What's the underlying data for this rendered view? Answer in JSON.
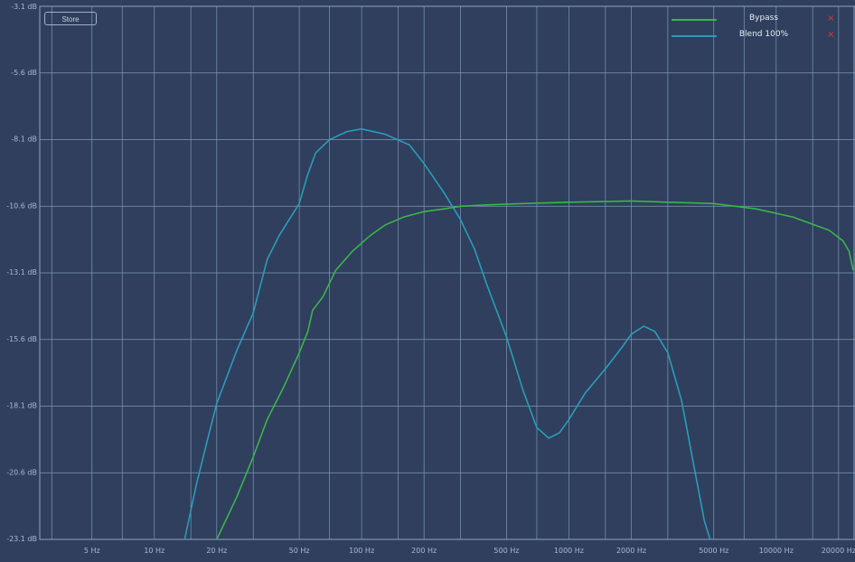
{
  "store_button": "Store",
  "legend": [
    {
      "label": "Bypass",
      "color": "#3bb54a",
      "remove": "×"
    },
    {
      "label": "Blend 100%",
      "color": "#2a9cbb",
      "remove": "×"
    }
  ],
  "chart_data": {
    "type": "line",
    "xscale": "log",
    "xlim": [
      2.8,
      24000
    ],
    "ylim": [
      -23.1,
      -3.1
    ],
    "grid": true,
    "legend_position": "top-right",
    "yticks": [
      -3.1,
      -5.6,
      -8.1,
      -10.6,
      -13.1,
      -15.6,
      -18.1,
      -20.6,
      -23.1
    ],
    "ytick_labels": [
      "-3.1 dB",
      "-5.6 dB",
      "-8.1 dB",
      "-10.6 dB",
      "-13.1 dB",
      "-15.6 dB",
      "-18.1 dB",
      "-20.6 dB",
      "-23.1 dB"
    ],
    "xticks": [
      5,
      10,
      20,
      50,
      100,
      200,
      500,
      1000,
      2000,
      5000,
      10000,
      20000
    ],
    "xtick_labels": [
      "5 Hz",
      "10 Hz",
      "20 Hz",
      "50 Hz",
      "100 Hz",
      "200 Hz",
      "500 Hz",
      "1000 Hz",
      "2000 Hz",
      "5000 Hz",
      "10000 Hz",
      "20000 Hz"
    ],
    "extra_gridlines_x": [
      3.2,
      7,
      15,
      30,
      70,
      150,
      300,
      700,
      1500,
      3000,
      7000,
      15000
    ],
    "series": [
      {
        "name": "Bypass",
        "color": "#3bb54a",
        "points": [
          [
            20,
            -23.1
          ],
          [
            25,
            -21.5
          ],
          [
            30,
            -20.0
          ],
          [
            35,
            -18.6
          ],
          [
            42,
            -17.4
          ],
          [
            50,
            -16.1
          ],
          [
            55,
            -15.3
          ],
          [
            58,
            -14.5
          ],
          [
            65,
            -14.0
          ],
          [
            75,
            -13.0
          ],
          [
            90,
            -12.3
          ],
          [
            110,
            -11.7
          ],
          [
            130,
            -11.3
          ],
          [
            160,
            -11.0
          ],
          [
            200,
            -10.8
          ],
          [
            250,
            -10.7
          ],
          [
            300,
            -10.6
          ],
          [
            400,
            -10.55
          ],
          [
            600,
            -10.5
          ],
          [
            1000,
            -10.45
          ],
          [
            2000,
            -10.4
          ],
          [
            3000,
            -10.45
          ],
          [
            5000,
            -10.5
          ],
          [
            8000,
            -10.7
          ],
          [
            12000,
            -11.0
          ],
          [
            18000,
            -11.5
          ],
          [
            21000,
            -11.9
          ],
          [
            22500,
            -12.3
          ],
          [
            23500,
            -13.0
          ]
        ]
      },
      {
        "name": "Blend 100%",
        "color": "#2a9cbb",
        "points": [
          [
            14,
            -23.1
          ],
          [
            16,
            -21.0
          ],
          [
            18,
            -19.4
          ],
          [
            20,
            -18.0
          ],
          [
            25,
            -16.0
          ],
          [
            30,
            -14.6
          ],
          [
            35,
            -12.6
          ],
          [
            40,
            -11.7
          ],
          [
            50,
            -10.5
          ],
          [
            55,
            -9.4
          ],
          [
            60,
            -8.6
          ],
          [
            70,
            -8.1
          ],
          [
            85,
            -7.8
          ],
          [
            100,
            -7.7
          ],
          [
            130,
            -7.9
          ],
          [
            170,
            -8.3
          ],
          [
            200,
            -9.0
          ],
          [
            250,
            -10.1
          ],
          [
            300,
            -11.1
          ],
          [
            350,
            -12.2
          ],
          [
            400,
            -13.5
          ],
          [
            500,
            -15.5
          ],
          [
            600,
            -17.5
          ],
          [
            700,
            -18.9
          ],
          [
            800,
            -19.3
          ],
          [
            900,
            -19.1
          ],
          [
            1000,
            -18.6
          ],
          [
            1200,
            -17.6
          ],
          [
            1500,
            -16.7
          ],
          [
            1800,
            -15.9
          ],
          [
            2000,
            -15.4
          ],
          [
            2300,
            -15.1
          ],
          [
            2600,
            -15.3
          ],
          [
            3000,
            -16.1
          ],
          [
            3500,
            -17.9
          ],
          [
            4000,
            -20.3
          ],
          [
            4500,
            -22.4
          ],
          [
            4800,
            -23.1
          ]
        ]
      }
    ]
  }
}
